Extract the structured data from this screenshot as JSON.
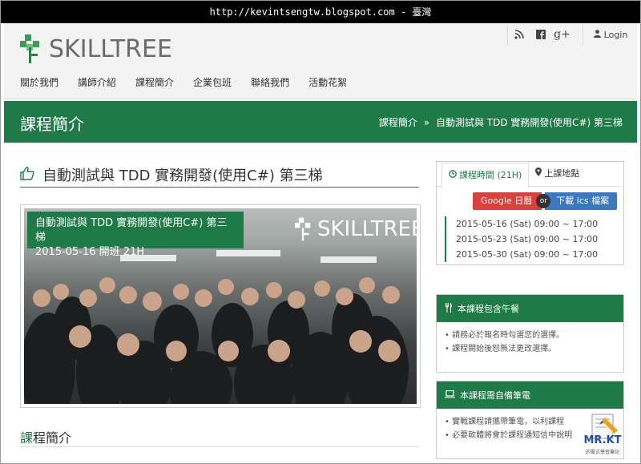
{
  "watermark_url": "http://kevintsengtw.blogspot.com - 臺灣",
  "brand": {
    "name": "SKILLTREE",
    "color": "#1e7a47"
  },
  "header": {
    "social": [
      "rss-icon",
      "facebook-icon",
      "google-plus-icon"
    ],
    "google_plus_label": "g+",
    "login_label": "Login"
  },
  "nav": {
    "items": [
      "關於我們",
      "講師介紹",
      "課程簡介",
      "企業包班",
      "聯絡我們",
      "活動花絮"
    ]
  },
  "band": {
    "title": "課程簡介",
    "breadcrumb_root": "課程簡介",
    "breadcrumb_sep": "»",
    "breadcrumb_current": "自動測試與 TDD 實務開發(使用C#) 第三梯"
  },
  "course": {
    "title": "自動測試與 TDD 實務開發(使用C#) 第三梯",
    "caption_line1": "自動測試與 TDD 實務開發(使用C#) 第三梯",
    "caption_line2": "2015-05-16 開班 21H",
    "photo_logo": "SKILLTREE",
    "section_title_first": "課",
    "section_title_rest": "程簡介"
  },
  "schedule": {
    "tab_time": "課程時間 (21H)",
    "tab_place": "上課地點",
    "google_button": "Google 日曆",
    "or_label": "or",
    "ics_button": "下載 ics 檔案",
    "dates": [
      "2015-05-16 (Sat) 09:00 ~ 17:00",
      "2015-05-23 (Sat) 09:00 ~ 17:00",
      "2015-05-30 (Sat) 09:00 ~ 17:00"
    ]
  },
  "lunch_panel": {
    "heading": "本課程包含午餐",
    "items": [
      "請務必於報名時勾選您的選擇。",
      "課程開始後恕無法更改選擇。"
    ]
  },
  "laptop_panel": {
    "heading": "本課程需自備筆電",
    "items": [
      "實戰課程請攜帶筆電，以利課程",
      "必要軟體將會於課程通知信中說明"
    ]
  },
  "corner_badge": {
    "title": "MR.KT",
    "subtitle": "的電式學習筆記"
  }
}
